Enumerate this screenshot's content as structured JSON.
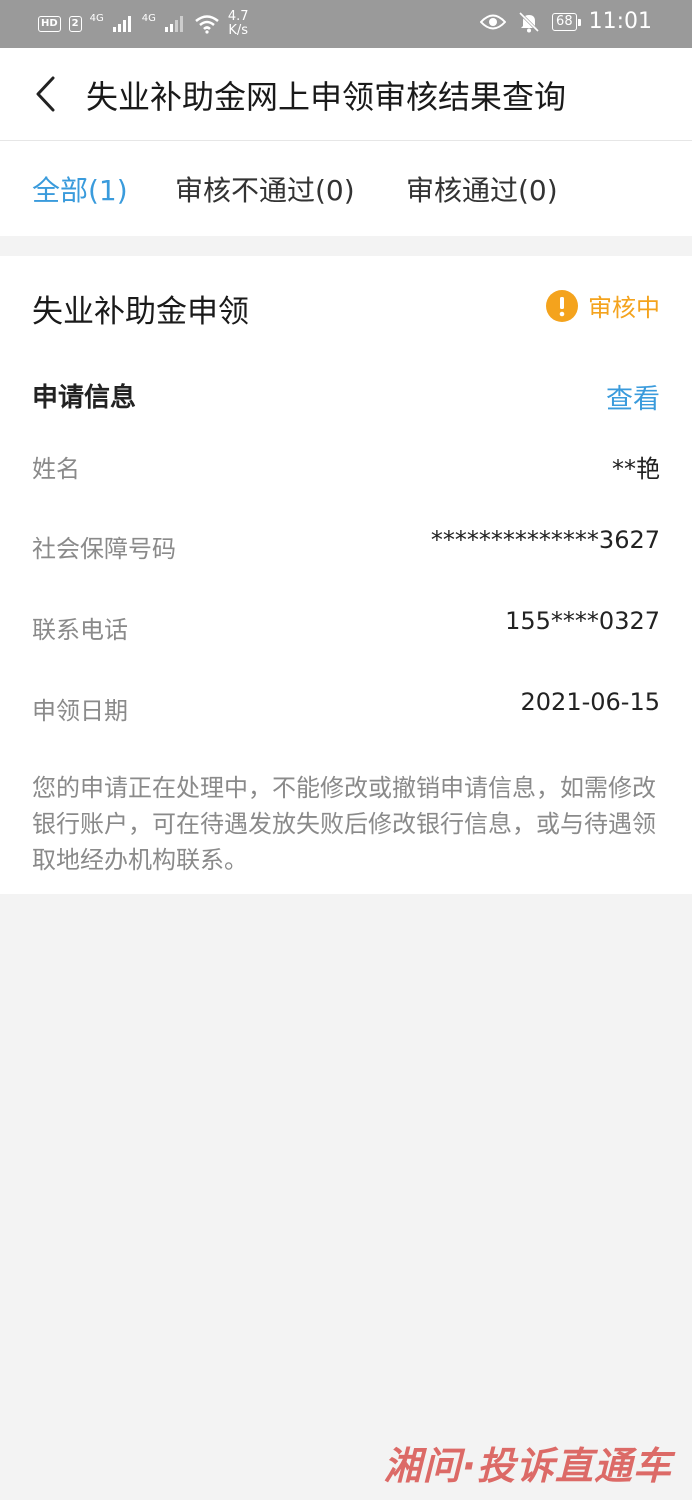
{
  "status_bar": {
    "hd_badge": "HD",
    "sim_badge": "2",
    "net1": "4G",
    "net2": "4G",
    "speed_value": "4.7",
    "speed_unit": "K/s",
    "battery": "68",
    "time": "11:01"
  },
  "nav": {
    "title": "失业补助金网上申领审核结果查询"
  },
  "tabs": [
    {
      "label": "全部(1)",
      "active": true
    },
    {
      "label": "审核不通过(0)",
      "active": false
    },
    {
      "label": "审核通过(0)",
      "active": false
    }
  ],
  "card": {
    "title": "失业补助金申领",
    "status": "审核中",
    "status_color": "#f4a31d",
    "section_title": "申请信息",
    "view_label": "查看",
    "rows": [
      {
        "label": "姓名",
        "value": "**艳"
      },
      {
        "label": "社会保障号码",
        "value": "**************3627"
      },
      {
        "label": "联系电话",
        "value": "155****0327"
      },
      {
        "label": "申领日期",
        "value": "2021-06-15"
      }
    ],
    "notice": "您的申请正在处理中，不能修改或撤销申请信息，如需修改银行账户，可在待遇发放失败后修改银行信息，或与待遇领取地经办机构联系。"
  },
  "watermark": {
    "text": "湘问·投诉直通车"
  },
  "colors": {
    "accent": "#3a9bdc",
    "warning": "#f4a31d",
    "background": "#f3f3f3"
  }
}
